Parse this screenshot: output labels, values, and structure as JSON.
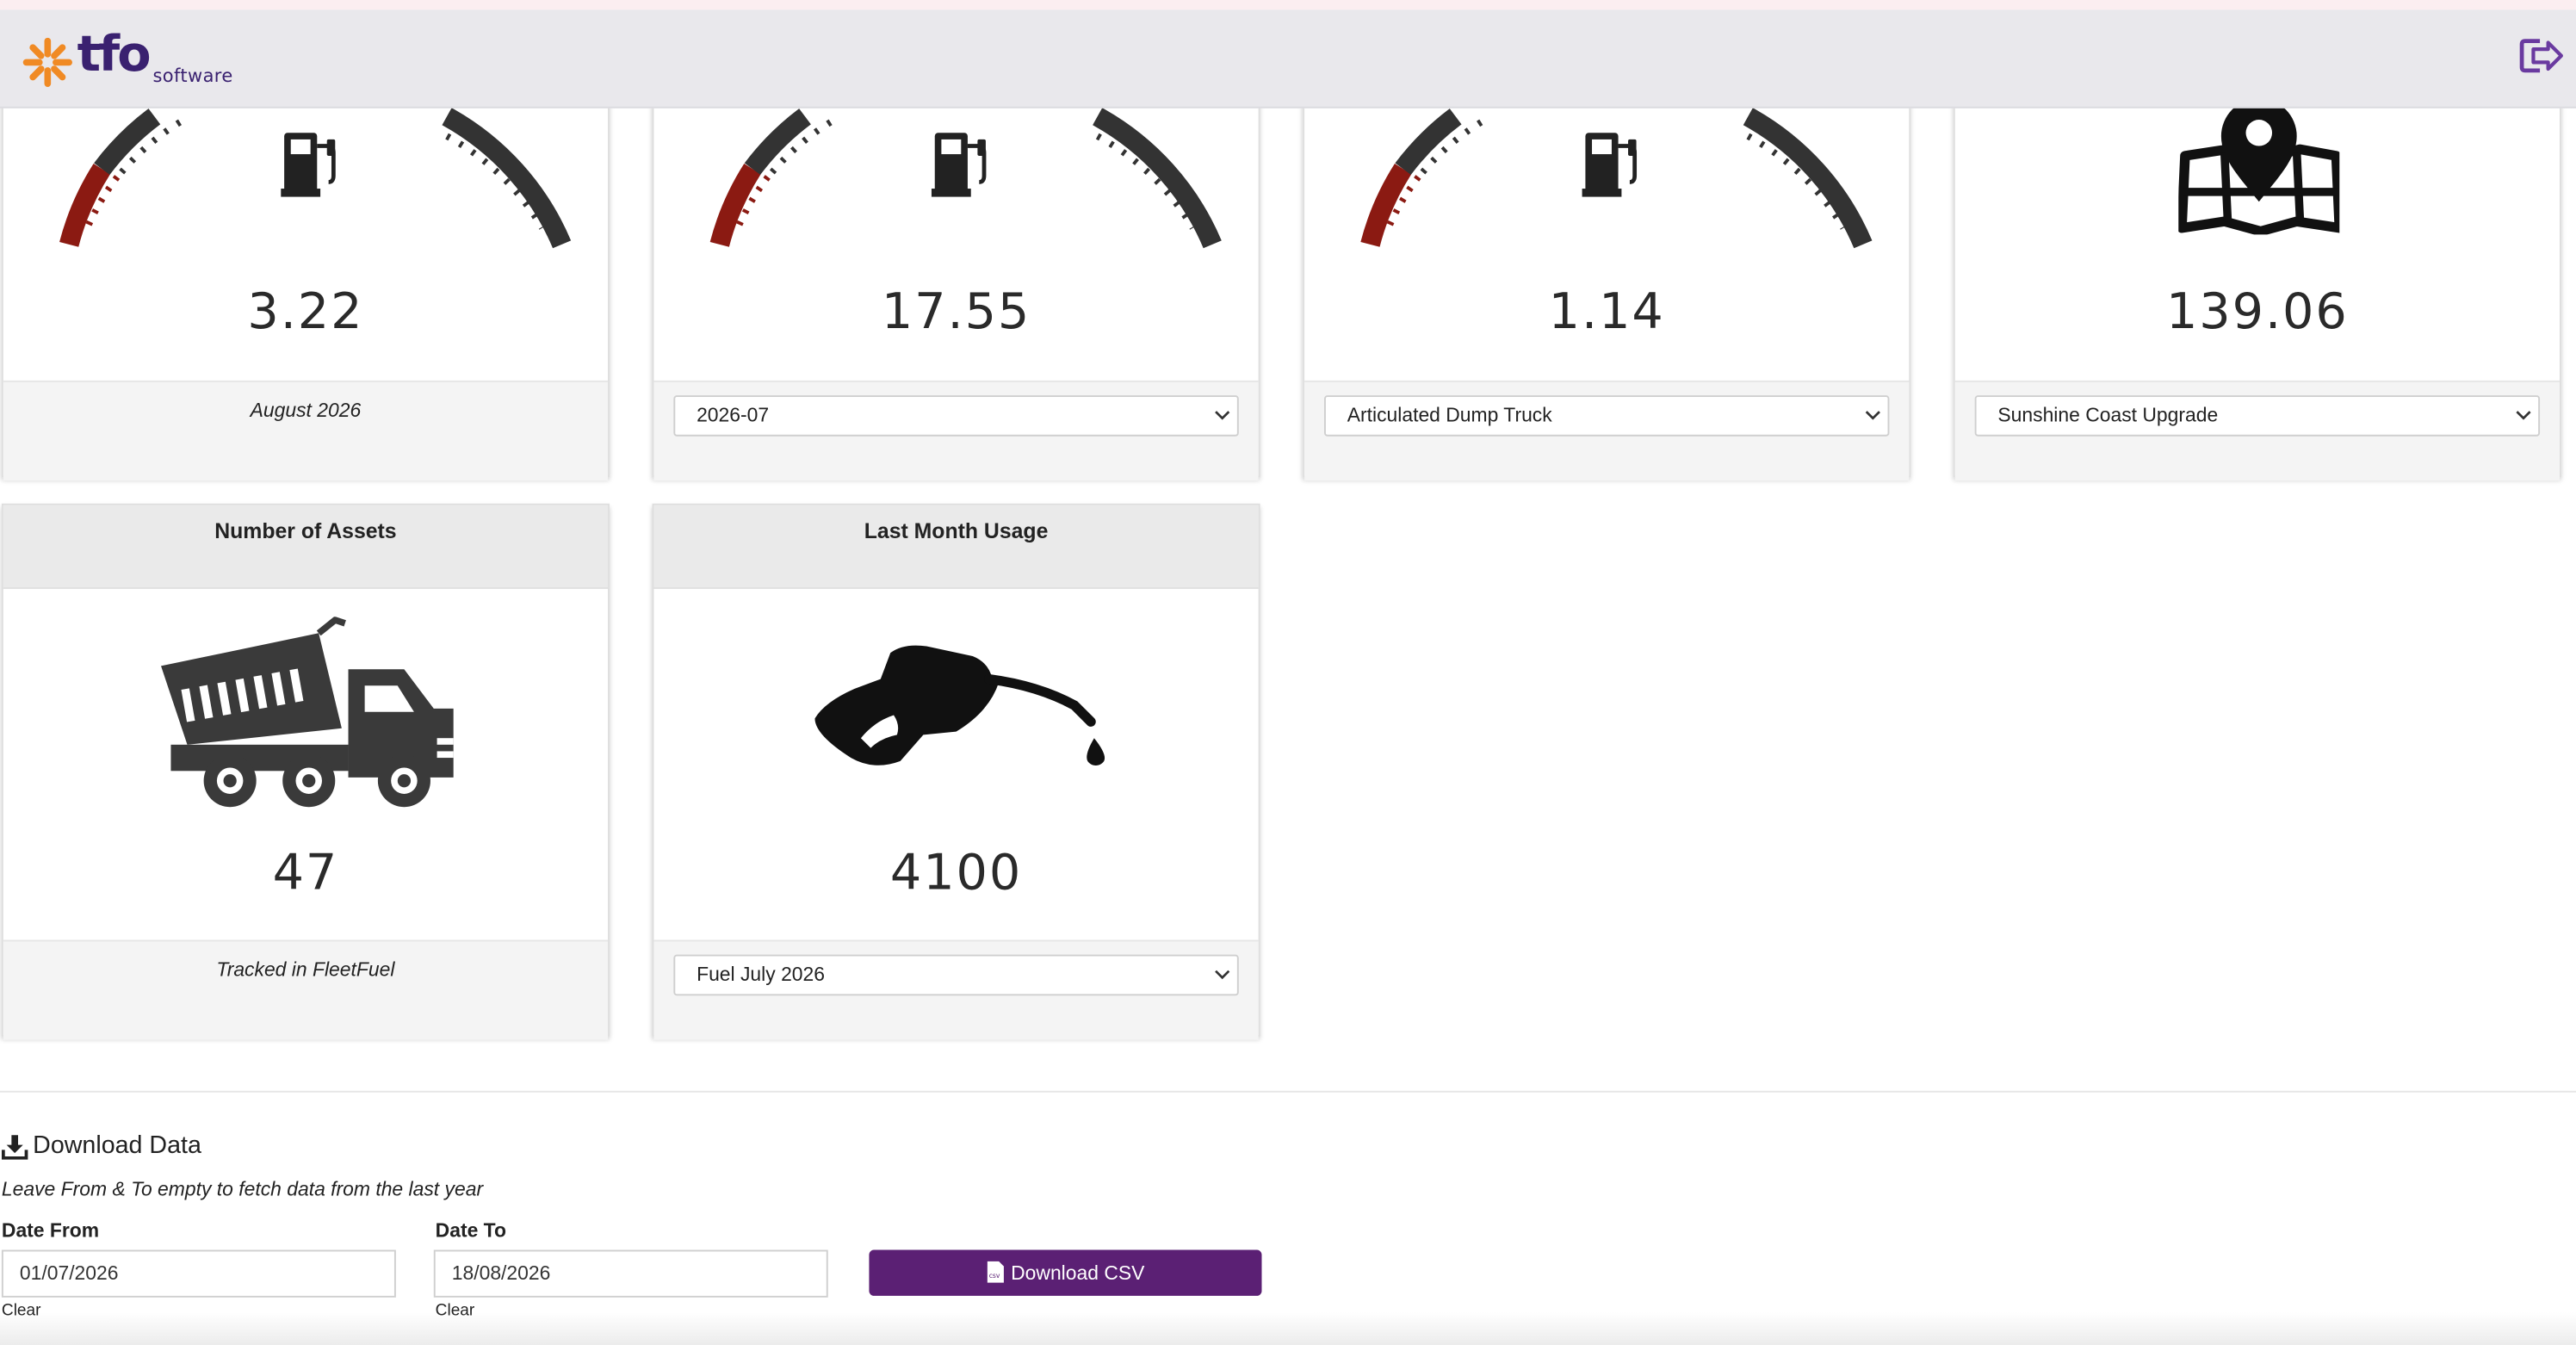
{
  "header": {
    "logo_main": "tfo",
    "logo_sub": "software",
    "logout_icon": "logout-arrow-icon"
  },
  "cards_row1": [
    {
      "value": "3.22",
      "icon": "fuel-gauge-icon",
      "footer_text": "August 2026"
    },
    {
      "value": "17.55",
      "icon": "fuel-gauge-icon",
      "select_value": "2026-07"
    },
    {
      "value": "1.14",
      "icon": "fuel-gauge-icon",
      "select_value": "Articulated Dump Truck"
    },
    {
      "value": "139.06",
      "icon": "map-pin-icon",
      "select_value": "Sunshine Coast Upgrade"
    }
  ],
  "cards_row2": [
    {
      "title": "Number of Assets",
      "value": "47",
      "icon": "dump-truck-icon",
      "footer_text": "Tracked in FleetFuel"
    },
    {
      "title": "Last Month Usage",
      "value": "4100",
      "icon": "fuel-nozzle-icon",
      "select_value": "Fuel July 2026"
    }
  ],
  "download": {
    "title": "Download Data",
    "hint": "Leave From & To empty to fetch data from the last year",
    "date_from_label": "Date From",
    "date_from_value": "01/07/2026",
    "date_to_label": "Date To",
    "date_to_value": "18/08/2026",
    "clear_label": "Clear",
    "button_label": "Download CSV"
  },
  "colors": {
    "brand_purple": "#5b2074",
    "logo_orange": "#f08a24",
    "gauge_red": "#8b1a12",
    "gauge_dark": "#333333"
  }
}
